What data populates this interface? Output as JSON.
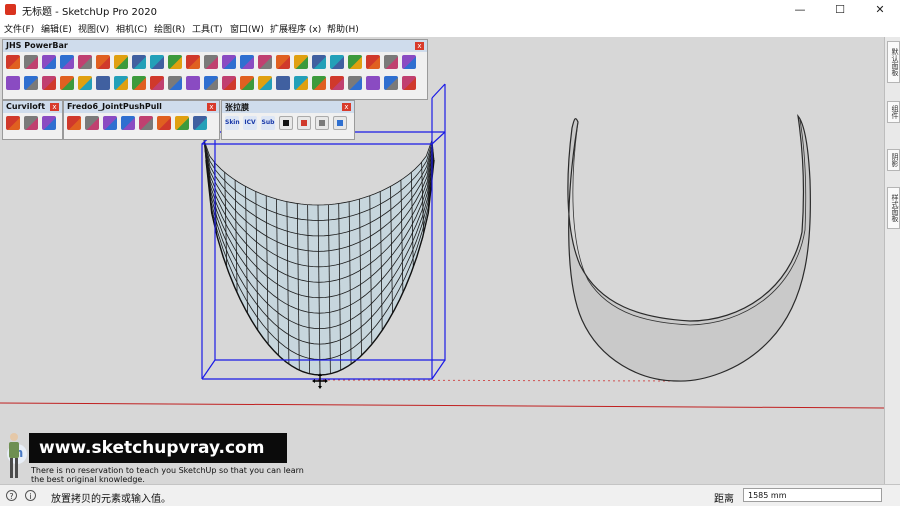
{
  "window": {
    "title": "无标题 - SketchUp Pro 2020",
    "controls": {
      "minimize": "—",
      "maximize": "☐",
      "close": "✕"
    }
  },
  "menubar": {
    "items": [
      "文件(F)",
      "编辑(E)",
      "视图(V)",
      "相机(C)",
      "绘图(R)",
      "工具(T)",
      "窗口(W)",
      "扩展程序 (x)",
      "帮助(H)"
    ]
  },
  "toolbars": {
    "powerbar": {
      "title": "JHS PowerBar",
      "close": "x"
    },
    "curviloft": {
      "title": "Curviloft",
      "close": "x"
    },
    "fredo": {
      "title": "Fredo6_JointPushPull",
      "close": "x"
    },
    "zhang": {
      "title": "张拉膜",
      "close": "x",
      "text_buttons": [
        "Skin",
        "ICV",
        "Sub"
      ]
    }
  },
  "right_tray": {
    "tabs": [
      "默认面板",
      "组件",
      "阴影",
      "样式面板"
    ]
  },
  "overlay": {
    "logo_letter": "m",
    "banner": "www.sketchupvray.com",
    "caption_lines": [
      "There is no reservation to teach you SketchUp so that you can learn",
      "the best original knowledge."
    ]
  },
  "statusbar": {
    "icons": [
      "?",
      "i"
    ],
    "message": "放置拷贝的元素或输入值。",
    "measurement_label": "距离",
    "measurement_value": "1585 mm"
  },
  "colors": {
    "viewport_bg": "#d7d7d7",
    "selection_blue": "#1a1ae6",
    "red_axis": "#c02020",
    "surface_fill": "#c7d6dd",
    "toolbar_header": "#cfdcec"
  }
}
